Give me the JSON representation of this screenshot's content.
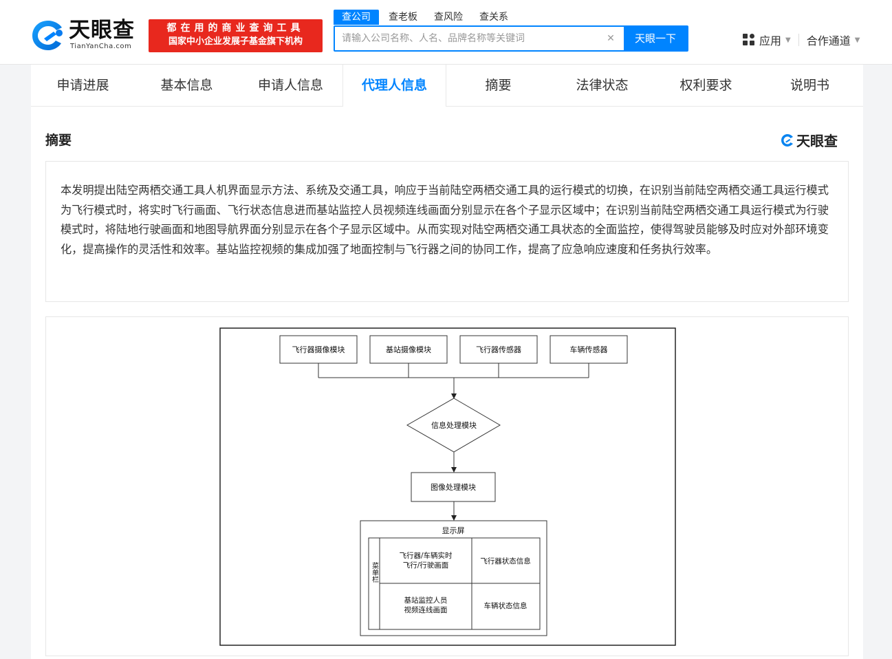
{
  "header": {
    "logo_cn": "天眼查",
    "logo_en": "TianYanCha.com",
    "slogan_line1": "都在用的商业查询工具",
    "slogan_line2": "国家中小企业发展子基金旗下机构",
    "search_tabs": [
      "查公司",
      "查老板",
      "查风险",
      "查关系"
    ],
    "search_placeholder": "请输入公司名称、人名、品牌名称等关键词",
    "search_button": "天眼一下",
    "nav_app": "应用",
    "nav_partner": "合作通道"
  },
  "tabs": [
    "申请进展",
    "基本信息",
    "申请人信息",
    "代理人信息",
    "摘要",
    "法律状态",
    "权利要求",
    "说明书"
  ],
  "active_tab": "代理人信息",
  "section": {
    "title": "摘要",
    "watermark": "天眼查",
    "abstract": "本发明提出陆空两栖交通工具人机界面显示方法、系统及交通工具，响应于当前陆空两栖交通工具的运行模式的切换，在识别当前陆空两栖交通工具运行模式为飞行模式时，将实时飞行画面、飞行状态信息进而基站监控人员视频连线画面分别显示在各个子显示区域中；在识别当前陆空两栖交通工具运行模式为行驶模式时，将陆地行驶画面和地图导航界面分别显示在各个子显示区域中。从而实现对陆空两栖交通工具状态的全面监控，使得驾驶员能够及时应对外部环境变化，提高操作的灵活性和效率。基站监控视频的集成加强了地面控制与飞行器之间的协同工作，提高了应急响应速度和任务执行效率。"
  },
  "diagram": {
    "sources": [
      "飞行器摄像模块",
      "基站摄像模块",
      "飞行器传感器",
      "车辆传感器"
    ],
    "decision": "信息处理模块",
    "image_processor": "图像处理模块",
    "screen": {
      "title": "显示屏",
      "menu": "菜单栏",
      "cell_1_line1": "飞行器/车辆实时",
      "cell_1_line2": "飞行/行驶画面",
      "cell_2": "飞行器状态信息",
      "cell_3_line1": "基站监控人员",
      "cell_3_line2": "视频连线画面",
      "cell_4": "车辆状态信息"
    }
  },
  "colors": {
    "brand": "#0084ff",
    "slogan_bg": "#e8281e"
  }
}
